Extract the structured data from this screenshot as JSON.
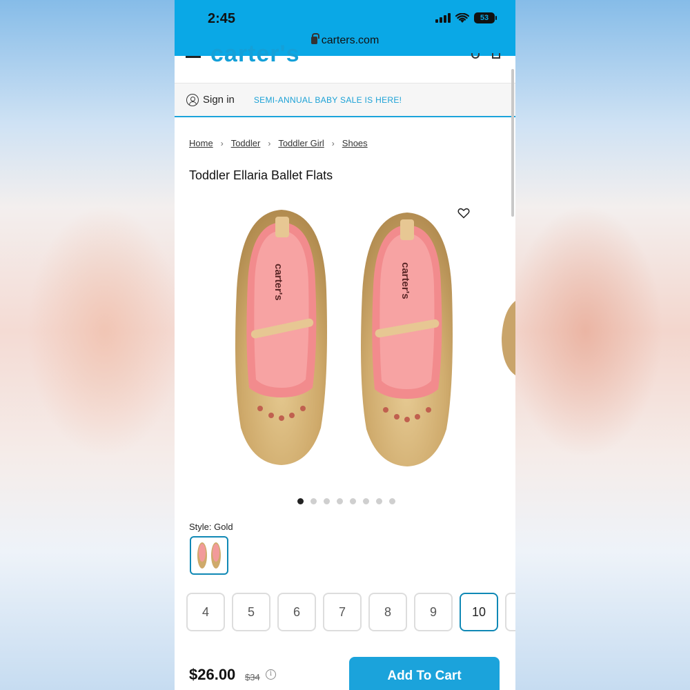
{
  "status_bar": {
    "time": "2:45",
    "battery": "53",
    "url": "carters.com",
    "bg_color": "#0aa8e6"
  },
  "header": {
    "logo_text": "carter's",
    "brand_color": "#14a0d8"
  },
  "signin_bar": {
    "signin_label": "Sign in",
    "promo_text": "SEMI-ANNUAL BABY SALE IS HERE!"
  },
  "breadcrumb": {
    "items": [
      "Home",
      "Toddler",
      "Toddler Girl",
      "Shoes"
    ],
    "separator": "›"
  },
  "product": {
    "title": "Toddler Ellaria Ballet Flats",
    "insole_brand_text": "carter's",
    "carousel_total": 8,
    "carousel_active_index": 0,
    "style_label": "Style: Gold",
    "sizes": [
      "4",
      "5",
      "6",
      "7",
      "8",
      "9",
      "10"
    ],
    "selected_size": "10",
    "price": "$26.00",
    "original_price": "$34",
    "info_glyph": "i",
    "add_to_cart_label": "Add To Cart",
    "accent_color": "#1ba3db",
    "selected_border_color": "#0f88b5"
  }
}
